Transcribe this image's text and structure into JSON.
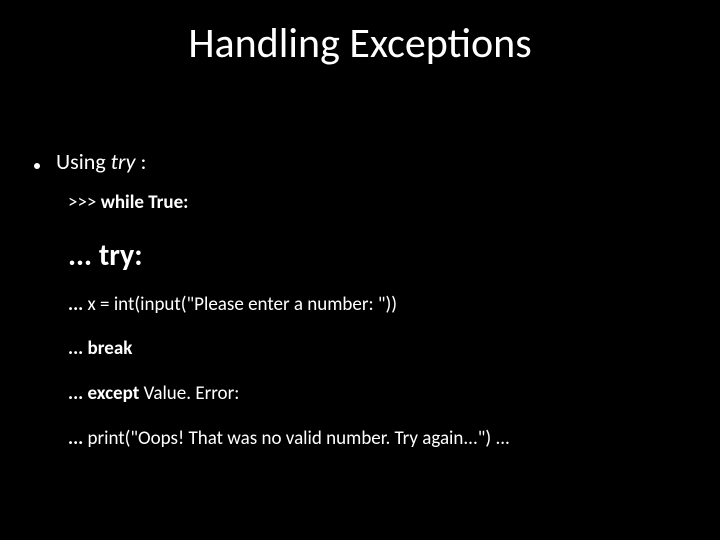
{
  "title": "Handling Exceptions",
  "bullet": {
    "prefix": "Using ",
    "kw": "try",
    "suffix": " :"
  },
  "code": {
    "l1_prompt": ">>> ",
    "l1_rest": "while True:",
    "l2_prompt": "... ",
    "l2_rest": "try:",
    "l3_prompt": "... ",
    "l3_rest": "x = int(input(\"Please enter a number: \"))",
    "l4_prompt": "... ",
    "l4_rest": "break",
    "l5_prompt": "... ",
    "l5_kw": "except ",
    "l5_rest": "Value. Error:",
    "l6_prompt": "... ",
    "l6_rest": "print(\"Oops! That was no valid number. Try again...\") ..."
  }
}
